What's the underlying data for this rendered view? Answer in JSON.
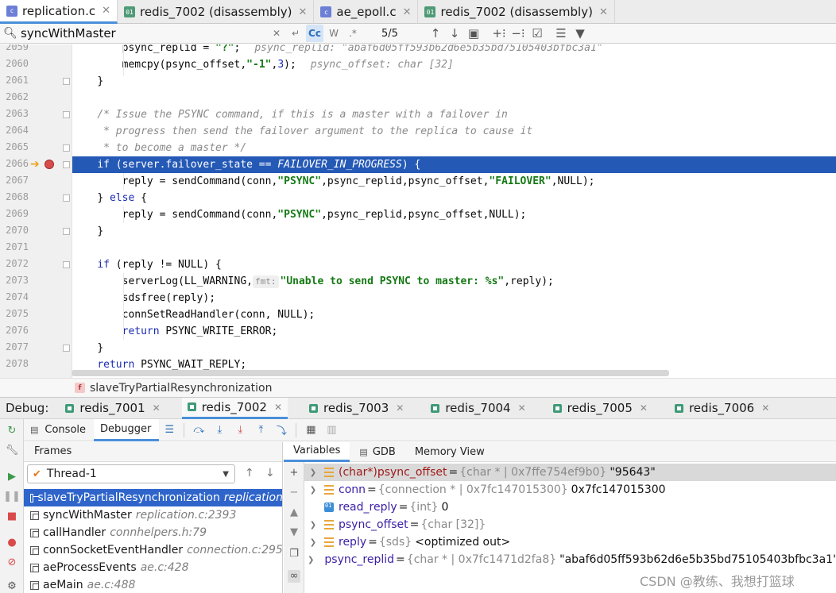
{
  "file_tabs": [
    {
      "label": "replication.c",
      "icon": "c-file-icon",
      "active": true
    },
    {
      "label": "redis_7002 (disassembly)",
      "icon": "disassembly-icon",
      "active": false
    },
    {
      "label": "ae_epoll.c",
      "icon": "c-file-icon",
      "active": false
    },
    {
      "label": "redis_7002 (disassembly)",
      "icon": "disassembly-icon",
      "active": false
    }
  ],
  "search": {
    "query": "syncWithMaster",
    "match_case_label": "Cc",
    "words_label": "W",
    "regex_label": ".*",
    "count": "5/5"
  },
  "editor": {
    "current_line": "2066",
    "lines": [
      {
        "n": "2059"
      },
      {
        "n": "2060"
      },
      {
        "n": "2061"
      },
      {
        "n": "2062"
      },
      {
        "n": "2063"
      },
      {
        "n": "2064"
      },
      {
        "n": "2065"
      },
      {
        "n": "2066"
      },
      {
        "n": "2067"
      },
      {
        "n": "2068"
      },
      {
        "n": "2069"
      },
      {
        "n": "2070"
      },
      {
        "n": "2071"
      },
      {
        "n": "2072"
      },
      {
        "n": "2073"
      },
      {
        "n": "2074"
      },
      {
        "n": "2075"
      },
      {
        "n": "2076"
      },
      {
        "n": "2077"
      },
      {
        "n": "2078"
      }
    ],
    "code": {
      "l2059a": "psync_replid = ",
      "l2059b": "\"?\"",
      "l2059c": ";",
      "l2059hint": "psync_replid: \"abaf6d05ff593b62d6e5b35bd75105403bfbc3a1\"",
      "l2060a": "memcpy(psync_offset,",
      "l2060b": "\"-1\"",
      "l2060c": ",",
      "l2060d": "3",
      "l2060e": ");",
      "l2060hint": "psync_offset: char [32]",
      "l2061": "}",
      "l2063": "/* Issue the PSYNC command, if this is a master with a failover in",
      "l2064": " * progress then send the failover argument to the replica to cause it",
      "l2065": " * to become a master */",
      "l2066a": "if",
      "l2066b": " (server.failover_state == ",
      "l2066c": "FAILOVER_IN_PROGRESS",
      "l2066d": ") {",
      "l2067a": "reply = sendCommand(conn,",
      "l2067b": "\"PSYNC\"",
      "l2067c": ",psync_replid,psync_offset,",
      "l2067d": "\"FAILOVER\"",
      "l2067e": ",NULL);",
      "l2068a": "} ",
      "l2068b": "else",
      "l2068c": " {",
      "l2069a": "reply = sendCommand(conn,",
      "l2069b": "\"PSYNC\"",
      "l2069c": ",psync_replid,psync_offset,NULL);",
      "l2070": "}",
      "l2072a": "if",
      "l2072b": " (reply != NULL) {",
      "l2073a": "serverLog(LL_WARNING,",
      "l2073fmt": "fmt:",
      "l2073b": "\"Unable to send PSYNC to master: %s\"",
      "l2073c": ",reply);",
      "l2074": "sdsfree(reply);",
      "l2075": "connSetReadHandler(conn, NULL);",
      "l2076a": "return",
      "l2076b": " PSYNC_WRITE_ERROR;",
      "l2077": "}",
      "l2078a": "return",
      "l2078b": " PSYNC_WAIT_REPLY;"
    }
  },
  "breadcrumb": {
    "function": "slaveTryPartialResynchronization",
    "badge": "f"
  },
  "debug": {
    "label": "Debug:",
    "sessions": [
      {
        "label": "redis_7001",
        "active": false
      },
      {
        "label": "redis_7002",
        "active": true
      },
      {
        "label": "redis_7003",
        "active": false
      },
      {
        "label": "redis_7004",
        "active": false
      },
      {
        "label": "redis_7005",
        "active": false
      },
      {
        "label": "redis_7006",
        "active": false
      }
    ],
    "subtabs": {
      "console": "Console",
      "debugger": "Debugger"
    }
  },
  "frames": {
    "header": "Frames",
    "thread": "Thread-1",
    "items": [
      {
        "func": "slaveTryPartialResynchronization",
        "loc": "replication",
        "selected": true
      },
      {
        "func": "syncWithMaster",
        "loc": "replication.c:2393",
        "selected": false
      },
      {
        "func": "callHandler",
        "loc": "connhelpers.h:79",
        "selected": false
      },
      {
        "func": "connSocketEventHandler",
        "loc": "connection.c:295",
        "selected": false
      },
      {
        "func": "aeProcessEvents",
        "loc": "ae.c:428",
        "selected": false
      },
      {
        "func": "aeMain",
        "loc": "ae.c:488",
        "selected": false
      }
    ]
  },
  "variables": {
    "tabs": {
      "variables": "Variables",
      "gdb": "GDB",
      "memory": "Memory View"
    },
    "items": [
      {
        "name": "(char*)psync_offset",
        "type": "{char * | 0x7ffe754ef9b0}",
        "value": "\"95643\"",
        "expandable": true,
        "kind": "field",
        "selected": true
      },
      {
        "name": "conn",
        "type": "{connection * | 0x7fc147015300}",
        "value": "0x7fc147015300",
        "expandable": true,
        "kind": "field",
        "selected": false
      },
      {
        "name": "read_reply",
        "type": "{int}",
        "value": "0",
        "expandable": false,
        "kind": "prim",
        "selected": false
      },
      {
        "name": "psync_offset",
        "type": "{char [32]}",
        "value": "",
        "expandable": true,
        "kind": "field",
        "selected": false
      },
      {
        "name": "reply",
        "type": "{sds}",
        "value": "<optimized out>",
        "expandable": true,
        "kind": "field",
        "selected": false
      },
      {
        "name": "psync_replid",
        "type": "{char * | 0x7fc1471d2fa8}",
        "value": "\"abaf6d05ff593b62d6e5b35bd75105403bfbc3a1\"",
        "expandable": true,
        "kind": "field",
        "selected": false
      }
    ]
  },
  "watermark": "CSDN @教练、我想打篮球",
  "colors": {
    "selection": "#2459b6",
    "keyword": "#1b2bb0",
    "string": "#147a14",
    "accent": "#4a8fd9"
  }
}
